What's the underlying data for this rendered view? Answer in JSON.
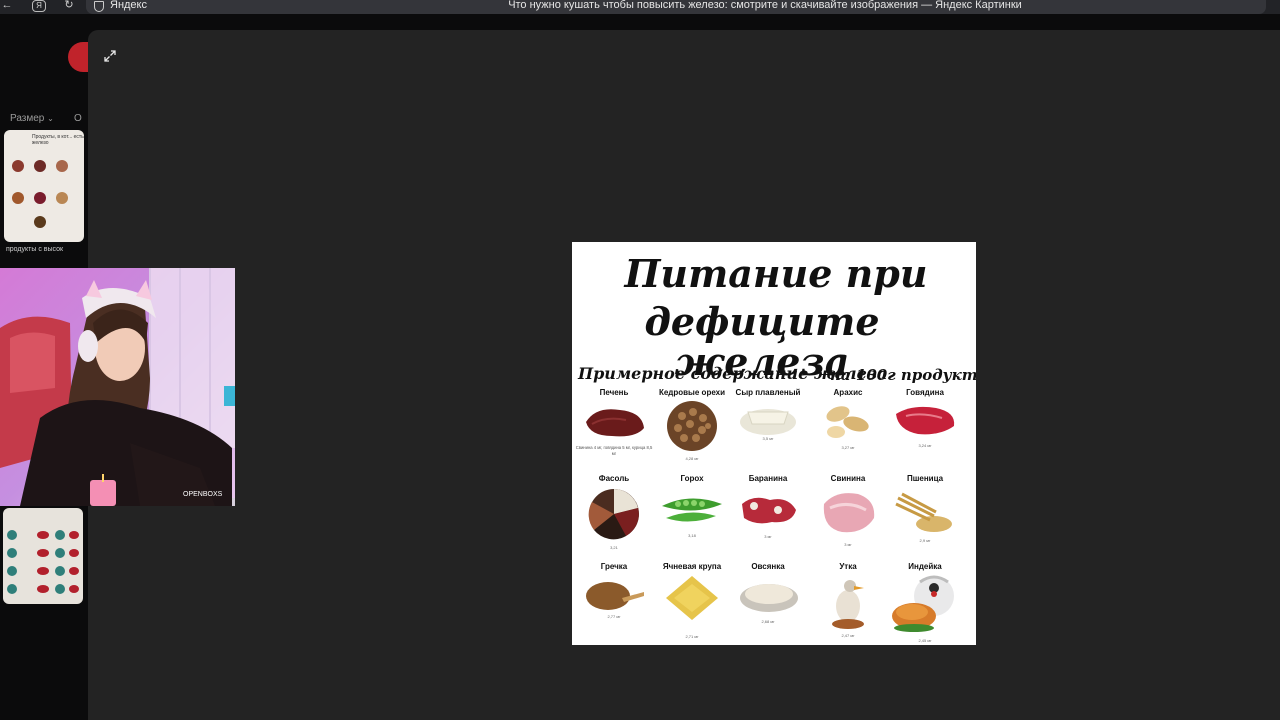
{
  "browser": {
    "site_name": "Яндекс",
    "page_title": "Что нужно кушать чтобы повысить железо: смотрите и скачивайте изображения — Яндекс Картинки"
  },
  "filters": {
    "size_label": "Размер",
    "other_label": "О"
  },
  "thumb_captions": {
    "first_title": "Продукты, в кот... есть железо",
    "second_title": "продукты с высок"
  },
  "webcam": {
    "watermark": "OPENBOXS"
  },
  "infographic": {
    "title_line1": "Питание при",
    "title_line2": "дефиците железа",
    "subtitle_part1": "Примерное содержание железа",
    "subtitle_part2": "на 100г продукта:",
    "liver_note": "Свинина 4 мг, говядина 5 мг, курица 8,5 мг",
    "foods": [
      {
        "name": "Печень",
        "value": ""
      },
      {
        "name": "Кедровые орехи",
        "value": "4,28 мг"
      },
      {
        "name": "Сыр плавленый",
        "value": "3,5 мг"
      },
      {
        "name": "Арахис",
        "value": "3,27 мг"
      },
      {
        "name": "Говядина",
        "value": "3,24 мг"
      },
      {
        "name": "Фасоль",
        "value": "3,21"
      },
      {
        "name": "Горох",
        "value": "3,18"
      },
      {
        "name": "Баранина",
        "value": "3 мг"
      },
      {
        "name": "Свинина",
        "value": "3 мг"
      },
      {
        "name": "Пшеница",
        "value": "2,9 мг"
      },
      {
        "name": "Гречка",
        "value": "2,77 мг"
      },
      {
        "name": "Ячневая крупа",
        "value": "2,71 мг"
      },
      {
        "name": "Овсянка",
        "value": "2,68 мг"
      },
      {
        "name": "Утка",
        "value": "2,47 мг"
      },
      {
        "name": "Индейка",
        "value": "2,45 мг"
      }
    ]
  }
}
